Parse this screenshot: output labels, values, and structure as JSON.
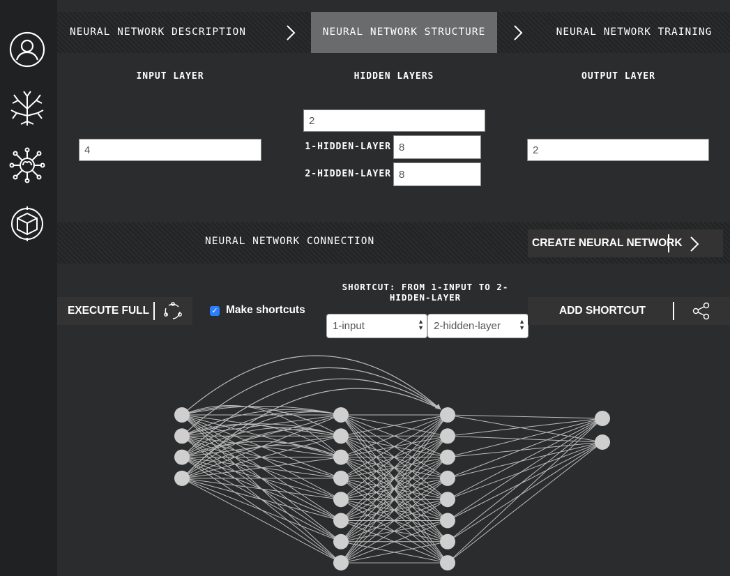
{
  "steps": [
    {
      "label": "NEURAL NETWORK DESCRIPTION",
      "active": false
    },
    {
      "label": "NEURAL NETWORK STRUCTURE",
      "active": true
    },
    {
      "label": "NEURAL NETWORK TRAINING",
      "active": false
    }
  ],
  "sidebar": {
    "icons": [
      "user-icon",
      "tree-icon",
      "brain-network-icon",
      "cube-icon"
    ]
  },
  "structure": {
    "input_title": "INPUT LAYER",
    "hidden_title": "HIDDEN LAYERS",
    "output_title": "OUTPUT LAYER",
    "input_value": "4",
    "hidden_count": "2",
    "hidden_layers": [
      {
        "label": "1-HIDDEN-LAYER",
        "value": "8"
      },
      {
        "label": "2-HIDDEN-LAYER",
        "value": "8"
      }
    ],
    "output_value": "2"
  },
  "connection": {
    "title": "NEURAL NETWORK CONNECTION",
    "create_label": "CREATE NEURAL NETWORK",
    "execute_label": "EXECUTE FULL",
    "make_shortcuts_label": "Make shortcuts",
    "make_shortcuts_checked": true,
    "shortcut_title": "SHORTCUT: FROM 1-INPUT TO 2-HIDDEN-LAYER",
    "from_select": "1-input",
    "to_select": "2-hidden-layer",
    "add_shortcut_label": "ADD SHORTCUT"
  },
  "network": {
    "layers": [
      4,
      8,
      8,
      2
    ],
    "shortcut": {
      "from": "1-input",
      "to": "2-hidden-layer",
      "node_from": 1,
      "node_to": 1
    },
    "colors": {
      "node": "#cfcfcf",
      "edge": "#bdbdbd"
    }
  }
}
